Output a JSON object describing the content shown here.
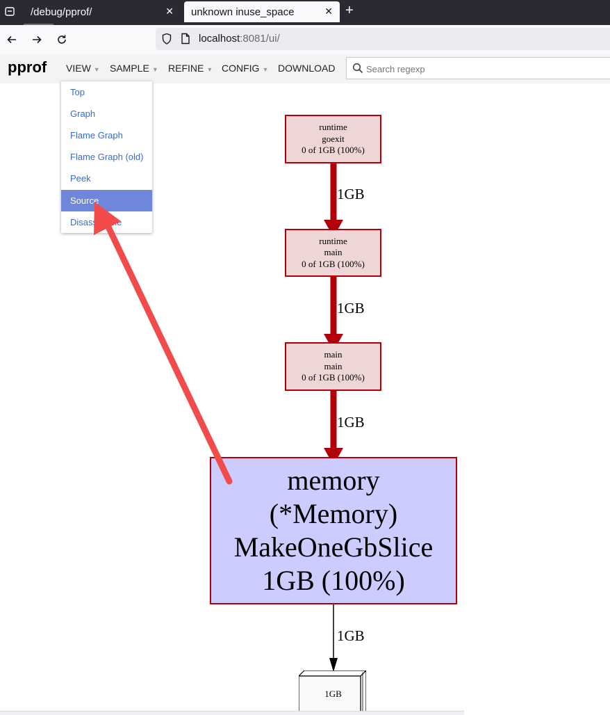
{
  "browser": {
    "tabs": [
      {
        "title": "/debug/pprof/",
        "active": false
      },
      {
        "title": "unknown inuse_space",
        "active": true
      }
    ],
    "url": {
      "host": "localhost",
      "rest": ":8081/ui/"
    }
  },
  "header": {
    "logo": "pprof",
    "menu": [
      "VIEW",
      "SAMPLE",
      "REFINE",
      "CONFIG",
      "DOWNLOAD"
    ],
    "search_placeholder": "Search regexp"
  },
  "view_menu": {
    "items": [
      "Top",
      "Graph",
      "Flame Graph",
      "Flame Graph (old)",
      "Peek",
      "Source",
      "Disassemble"
    ],
    "selected": "Source"
  },
  "graph": {
    "nodes": [
      {
        "lines": [
          "runtime",
          "goexit",
          "0 of 1GB (100%)"
        ]
      },
      {
        "lines": [
          "runtime",
          "main",
          "0 of 1GB (100%)"
        ]
      },
      {
        "lines": [
          "main",
          "main",
          "0 of 1GB (100%)"
        ]
      },
      {
        "lines": [
          "memory",
          "(*Memory)",
          "MakeOneGbSlice",
          "1GB (100%)"
        ]
      }
    ],
    "edges": [
      "1GB",
      "1GB",
      "1GB",
      "1GB"
    ],
    "leaf": "1GB"
  },
  "colors": {
    "node_border": "#b2000a",
    "node_fill": "#edd6d5",
    "hot_node_fill": "#ccccff",
    "edge": "#b2000a",
    "annotation_arrow": "#f14b4b",
    "menu_selected": "#6f87da",
    "menu_link": "#3a6bc9"
  }
}
